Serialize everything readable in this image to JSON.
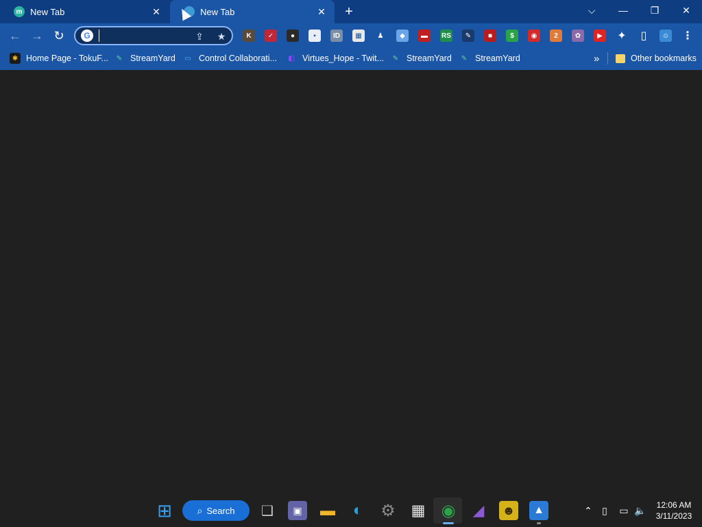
{
  "tabs": [
    {
      "title": "New Tab",
      "favicon": "m",
      "active": false
    },
    {
      "title": "New Tab",
      "favicon": "",
      "active": true
    }
  ],
  "tab_close_glyph": "✕",
  "new_tab_glyph": "+",
  "window_controls": {
    "tabsearch": "⌵",
    "minimize": "—",
    "restore": "❐",
    "close": "✕"
  },
  "toolbar": {
    "back": "←",
    "forward": "→",
    "reload": "↻",
    "omnibox_value": "",
    "google_logo": "G",
    "share_icon": "⇪",
    "star_icon": "★"
  },
  "extensions": [
    {
      "name": "ext-k-icon",
      "glyph": "K",
      "color": "#5a4a3a"
    },
    {
      "name": "ext-check-icon",
      "glyph": "✓",
      "color": "#c0283a"
    },
    {
      "name": "ext-red-circle-icon",
      "glyph": "●",
      "color": "#2a2a2a"
    },
    {
      "name": "ext-white-square-icon",
      "glyph": "▪",
      "color": "#e8eef8"
    },
    {
      "name": "ext-id-icon",
      "glyph": "ID",
      "color": "#7a8ea8"
    },
    {
      "name": "ext-grid-icon",
      "glyph": "▦",
      "color": "#e9e9e9"
    },
    {
      "name": "ext-stamp-icon",
      "glyph": "♟",
      "color": "#1a55a6"
    },
    {
      "name": "ext-roblox-icon",
      "glyph": "◆",
      "color": "#6aa5e8"
    },
    {
      "name": "ext-red-bar-icon",
      "glyph": "▬",
      "color": "#c02020"
    },
    {
      "name": "ext-green-circle-icon",
      "glyph": "RS",
      "color": "#1f8f4a"
    },
    {
      "name": "ext-pen-icon",
      "glyph": "✎",
      "color": "#1a3a6a"
    },
    {
      "name": "ext-red-square-icon",
      "glyph": "■",
      "color": "#b81c1c"
    },
    {
      "name": "ext-dollar-icon",
      "glyph": "$",
      "color": "#2aa348"
    },
    {
      "name": "ext-red-shape-icon",
      "glyph": "◉",
      "color": "#d42a2a"
    },
    {
      "name": "ext-badge-icon",
      "glyph": "2",
      "color": "#e07a3a"
    },
    {
      "name": "ext-cat-icon",
      "glyph": "✿",
      "color": "#8a6aa8"
    },
    {
      "name": "ext-youtube-icon",
      "glyph": "▶",
      "color": "#e02424"
    },
    {
      "name": "extensions-puzzle-icon",
      "glyph": "✦",
      "color": "transparent"
    },
    {
      "name": "side-panel-icon",
      "glyph": "▯",
      "color": "transparent"
    },
    {
      "name": "profile-avatar-icon",
      "glyph": "☺",
      "color": "#3a8ad6"
    },
    {
      "name": "menu-kebab-icon",
      "glyph": "⋮",
      "color": "transparent"
    }
  ],
  "bookmarks": [
    {
      "label": "Home Page - TokuF...",
      "icon": "✱",
      "icon_color": "#f0c020"
    },
    {
      "label": "StreamYard",
      "icon": "✎",
      "icon_color": "#6ad0a0"
    },
    {
      "label": "Control Collaborati...",
      "icon": "▭",
      "icon_color": "#4ab0e8"
    },
    {
      "label": "Virtues_Hope - Twit...",
      "icon": "◧",
      "icon_color": "#9147ff"
    },
    {
      "label": "StreamYard",
      "icon": "✎",
      "icon_color": "#6ad0a0"
    },
    {
      "label": "StreamYard",
      "icon": "✎",
      "icon_color": "#6ad0a0"
    }
  ],
  "bookmarks_overflow": "»",
  "other_bookmarks": "Other bookmarks",
  "taskbar": {
    "search_label": "Search",
    "search_glyph": "⌕",
    "apps": [
      {
        "name": "start-windows-icon",
        "glyph": "⊞",
        "color": "#3aa0f0"
      },
      {
        "name": "task-view-icon",
        "glyph": "❑",
        "color": "#c8c8c8"
      },
      {
        "name": "teams-chat-icon",
        "glyph": "▣",
        "color": "#6264a7"
      },
      {
        "name": "file-explorer-icon",
        "glyph": "▬",
        "color": "#f0b429"
      },
      {
        "name": "edge-icon",
        "glyph": "◐",
        "color": "#1fa0e0"
      },
      {
        "name": "settings-gear-icon",
        "glyph": "⚙",
        "color": "#8a8a8a"
      },
      {
        "name": "microsoft-store-icon",
        "glyph": "▦",
        "color": "#e8e8e8"
      },
      {
        "name": "chrome-icon",
        "glyph": "◉",
        "color": "#2aa348"
      },
      {
        "name": "visual-studio-icon",
        "glyph": "◢",
        "color": "#8a5ad6"
      },
      {
        "name": "game-frog-icon",
        "glyph": "☻",
        "color": "#d6b21a"
      },
      {
        "name": "photos-icon",
        "glyph": "▲",
        "color": "#2a7ad6"
      }
    ],
    "tray": {
      "chevron": "⌃",
      "tablet": "▯",
      "network": "▭",
      "volume": "🔈"
    },
    "time": "12:06 AM",
    "date": "3/11/2023"
  }
}
